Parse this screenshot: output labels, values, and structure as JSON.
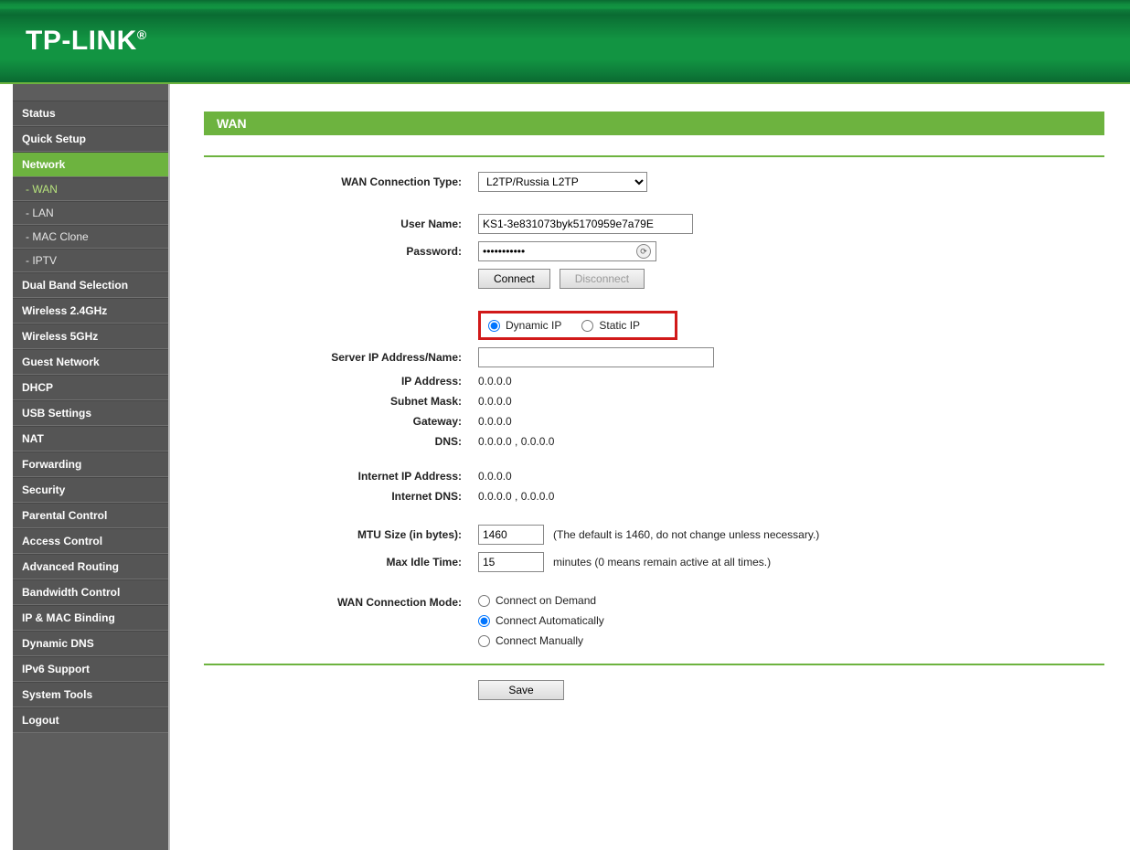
{
  "brand": "TP-LINK",
  "sidebar": {
    "items": [
      {
        "label": "Status",
        "type": "item"
      },
      {
        "label": "Quick Setup",
        "type": "item"
      },
      {
        "label": "Network",
        "type": "item",
        "active": true
      },
      {
        "label": "- WAN",
        "type": "sub",
        "current": true
      },
      {
        "label": "- LAN",
        "type": "sub"
      },
      {
        "label": "- MAC Clone",
        "type": "sub"
      },
      {
        "label": "- IPTV",
        "type": "sub"
      },
      {
        "label": "Dual Band Selection",
        "type": "item"
      },
      {
        "label": "Wireless 2.4GHz",
        "type": "item"
      },
      {
        "label": "Wireless 5GHz",
        "type": "item"
      },
      {
        "label": "Guest Network",
        "type": "item"
      },
      {
        "label": "DHCP",
        "type": "item"
      },
      {
        "label": "USB Settings",
        "type": "item"
      },
      {
        "label": "NAT",
        "type": "item"
      },
      {
        "label": "Forwarding",
        "type": "item"
      },
      {
        "label": "Security",
        "type": "item"
      },
      {
        "label": "Parental Control",
        "type": "item"
      },
      {
        "label": "Access Control",
        "type": "item"
      },
      {
        "label": "Advanced Routing",
        "type": "item"
      },
      {
        "label": "Bandwidth Control",
        "type": "item"
      },
      {
        "label": "IP & MAC Binding",
        "type": "item"
      },
      {
        "label": "Dynamic DNS",
        "type": "item"
      },
      {
        "label": "IPv6 Support",
        "type": "item"
      },
      {
        "label": "System Tools",
        "type": "item"
      },
      {
        "label": "Logout",
        "type": "item"
      }
    ]
  },
  "page": {
    "title": "WAN",
    "labels": {
      "conn_type": "WAN Connection Type:",
      "user": "User Name:",
      "password": "Password:",
      "server": "Server IP Address/Name:",
      "ip": "IP Address:",
      "mask": "Subnet Mask:",
      "gateway": "Gateway:",
      "dns": "DNS:",
      "inet_ip": "Internet IP Address:",
      "inet_dns": "Internet DNS:",
      "mtu": "MTU Size (in bytes):",
      "idle": "Max Idle Time:",
      "mode": "WAN Connection Mode:"
    },
    "values": {
      "conn_type_selected": "L2TP/Russia L2TP",
      "user": "KS1-3e831073byk5170959e7a79E",
      "password": "•••••••••••",
      "server": "",
      "ip": "0.0.0.0",
      "mask": "0.0.0.0",
      "gateway": "0.0.0.0",
      "dns": "0.0.0.0 , 0.0.0.0",
      "inet_ip": "0.0.0.0",
      "inet_dns": "0.0.0.0 , 0.0.0.0",
      "mtu": "1460",
      "idle": "15"
    },
    "buttons": {
      "connect": "Connect",
      "disconnect": "Disconnect",
      "save": "Save"
    },
    "radios": {
      "ip_mode": {
        "dynamic": "Dynamic IP",
        "static": "Static IP",
        "selected": "dynamic"
      },
      "mode": {
        "demand": "Connect on Demand",
        "auto": "Connect Automatically",
        "manual": "Connect Manually",
        "selected": "auto"
      }
    },
    "notes": {
      "mtu": "(The default is 1460, do not change unless necessary.)",
      "idle": "minutes (0 means remain active at all times.)"
    }
  }
}
